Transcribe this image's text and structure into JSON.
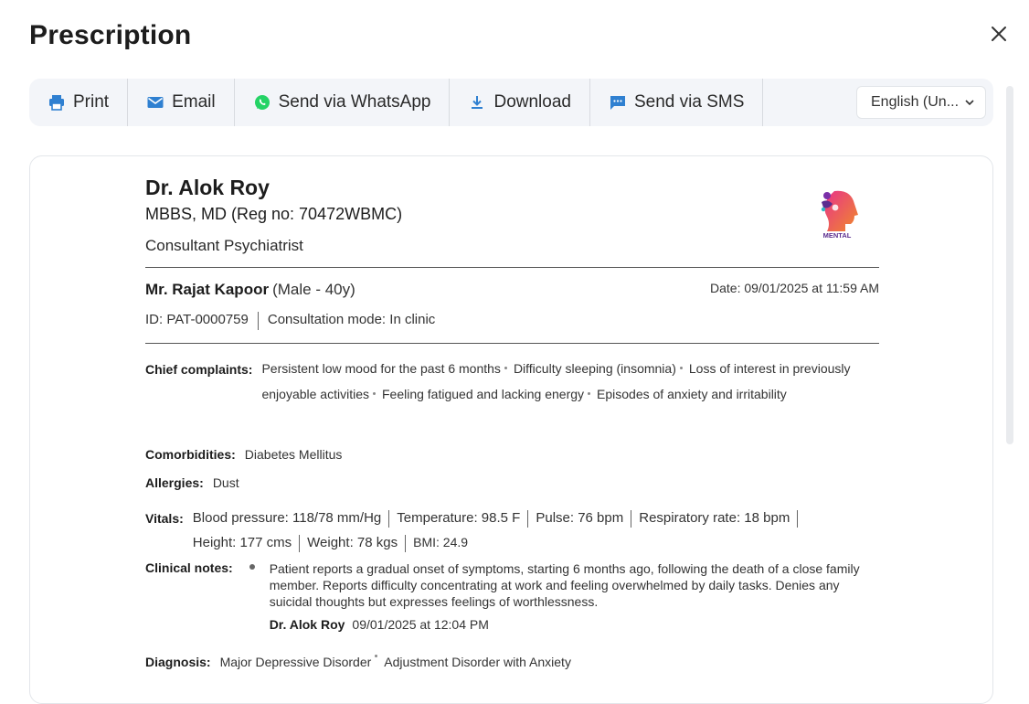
{
  "title": "Prescription",
  "toolbar": {
    "print": "Print",
    "email": "Email",
    "whatsapp": "Send via WhatsApp",
    "download": "Download",
    "sms": "Send via SMS",
    "language": "English (Un..."
  },
  "doctor": {
    "name": "Dr. Alok Roy",
    "qualification": "MBBS, MD (Reg no: 70472WBMC)",
    "specialty": "Consultant Psychiatrist",
    "logo_text": "MENTAL"
  },
  "patient": {
    "name": "Mr. Rajat Kapoor",
    "meta": "(Male - 40y)",
    "date": "Date: 09/01/2025 at 11:59 AM",
    "id": "ID: PAT-0000759",
    "mode": "Consultation mode: In clinic"
  },
  "chief_complaints": {
    "label": "Chief complaints:",
    "items": [
      "Persistent low mood for the past 6 months",
      "Difficulty sleeping (insomnia)",
      "Loss of interest in previously enjoyable activities",
      "Feeling fatigued and lacking energy",
      "Episodes of anxiety and irritability"
    ]
  },
  "comorbidities": {
    "label": "Comorbidities:",
    "value": "Diabetes Mellitus"
  },
  "allergies": {
    "label": "Allergies:",
    "value": "Dust"
  },
  "vitals": {
    "label": "Vitals:",
    "items": [
      "Blood pressure: 118/78 mm/Hg",
      "Temperature: 98.5 F",
      "Pulse: 76 bpm",
      "Respiratory rate: 18 bpm",
      "Height: 177 cms",
      "Weight: 78 kgs",
      "BMI: 24.9"
    ]
  },
  "clinical_notes": {
    "label": "Clinical notes:",
    "text": "Patient reports a gradual onset of symptoms, starting 6 months ago, following the death of a close family member. Reports difficulty concentrating at work and feeling overwhelmed by daily tasks. Denies any suicidal thoughts but expresses feelings of worthlessness.",
    "author": "Dr. Alok Roy",
    "timestamp": "09/01/2025 at 12:04 PM"
  },
  "diagnosis": {
    "label": "Diagnosis:",
    "items": [
      "Major Depressive Disorder",
      "Adjustment Disorder with Anxiety"
    ]
  },
  "colors": {
    "whatsapp": "#25d366",
    "accent": "#2f80d1",
    "logo_pink": "#e8338a",
    "logo_orange": "#f08a2a"
  }
}
